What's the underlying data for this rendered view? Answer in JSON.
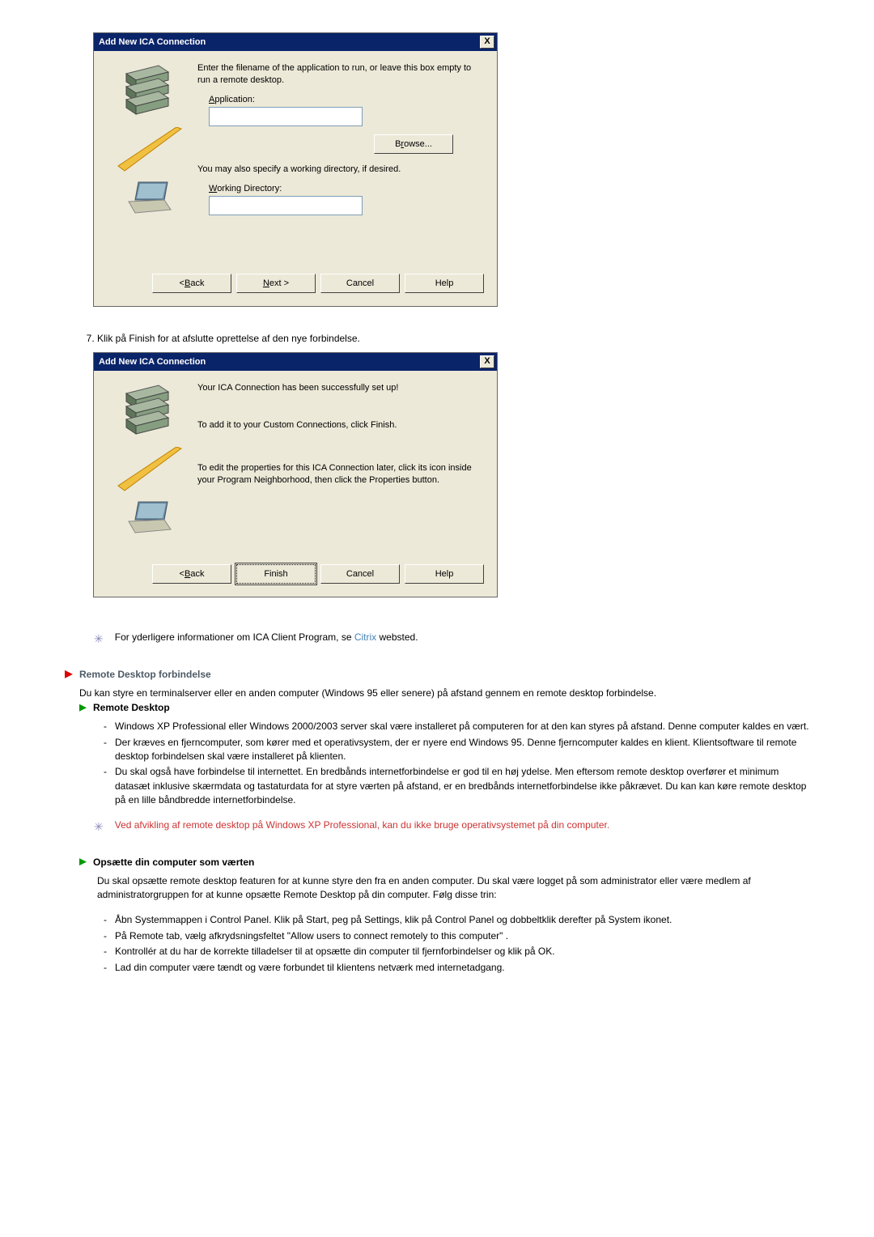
{
  "wizard_title": "Add New ICA Connection",
  "close_x": "X",
  "dlg1": {
    "intro": "Enter the filename of the application to run, or leave this box empty to run a remote desktop.",
    "application_label": "Application:",
    "application_value": "",
    "browse": "Browse...",
    "workdir_intro": "You may also specify a working directory, if desired.",
    "workdir_label": "Working Directory:",
    "workdir_value": ""
  },
  "dlg2": {
    "line1": "Your ICA Connection has been successfully set up!",
    "line2": "To add it to your Custom Connections, click Finish.",
    "line3": "To edit the properties for this ICA Connection later, click its icon inside your Program Neighborhood, then click the Properties button."
  },
  "nav": {
    "back": "Back",
    "next": "Next >",
    "finish": "Finish",
    "cancel": "Cancel",
    "help": "Help",
    "back_prefix": "< "
  },
  "step7": "Klik på Finish for at afslutte oprettelse af den nye forbindelse.",
  "note_citrix": {
    "pre": "For yderligere informationer om ICA Client Program, se ",
    "link": "Citrix",
    "post": " websted."
  },
  "rd_header": "Remote Desktop forbindelse",
  "rd_intro": "Du kan styre en terminalserver eller en anden computer (Windows 95 eller senere) på afstand gennem en remote desktop forbindelse.",
  "rd_subhead": "Remote Desktop",
  "rd_points": [
    "Windows XP Professional eller Windows 2000/2003 server skal være installeret på computeren for at den kan styres på afstand. Denne computer kaldes en vært.",
    "Der kræves en fjerncomputer, som kører med et operativsystem, der er nyere end Windows 95. Denne fjerncomputer kaldes en klient. Klientsoftware til remote desktop forbindelsen skal være installeret på klienten.",
    "Du skal også have forbindelse til internettet. En bredbånds internetforbindelse er god til en høj ydelse. Men eftersom remote desktop overfører et minimum datasæt inklusive skærmdata og tastaturdata for at styre værten på afstand, er en bredbånds internetforbindelse ikke påkrævet. Du kan kan køre remote desktop på en lille båndbredde internetforbindelse."
  ],
  "rd_warn": "Ved afvikling af remote desktop på Windows XP Professional, kan du ikke bruge operativsystemet på din computer.",
  "host_header": "Opsætte din computer som værten",
  "host_intro": "Du skal opsætte remote desktop featuren for at kunne styre den fra en anden computer. Du skal være logget på som administrator eller være medlem af administratorgruppen for at kunne opsætte Remote Desktop på din computer. Følg disse trin:",
  "host_points": [
    "Åbn Systemmappen i Control Panel. Klik på Start, peg på Settings, klik på Control Panel og dobbeltklik derefter på System ikonet.",
    "På Remote tab, vælg afkrydsningsfeltet \"Allow users to connect remotely to this computer\" .",
    "Kontrollér at du har de korrekte tilladelser til at opsætte din computer til fjernforbindelser og klik på OK.",
    "Lad din computer være tændt og være forbundet til klientens netværk med internetadgang."
  ]
}
